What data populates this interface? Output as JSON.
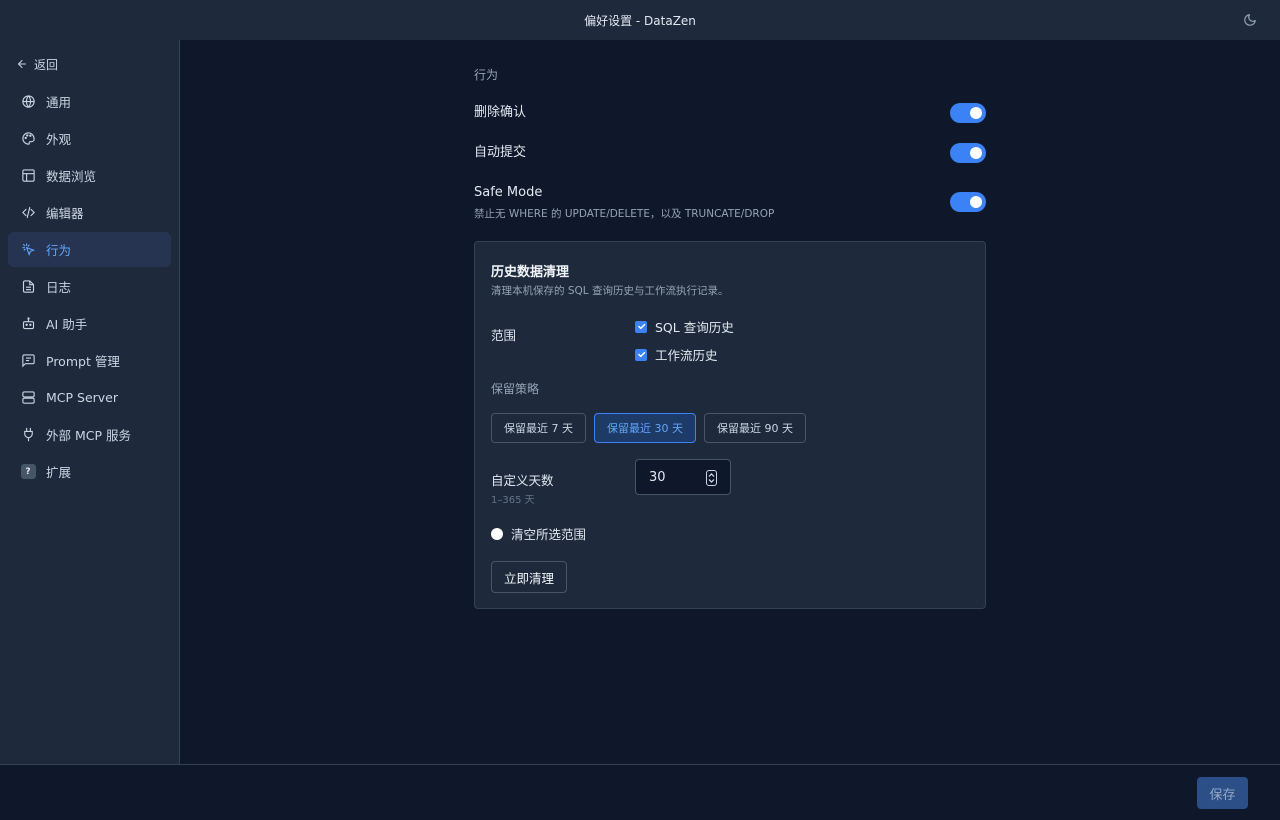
{
  "window": {
    "title": "偏好设置 - DataZen"
  },
  "sidebar": {
    "back_label": "返回",
    "items": [
      {
        "label": "通用",
        "icon": "globe-icon"
      },
      {
        "label": "外观",
        "icon": "palette-icon"
      },
      {
        "label": "数据浏览",
        "icon": "table-icon"
      },
      {
        "label": "编辑器",
        "icon": "code-icon"
      },
      {
        "label": "行为",
        "icon": "pointer-click-icon",
        "active": true
      },
      {
        "label": "日志",
        "icon": "file-text-icon"
      },
      {
        "label": "AI 助手",
        "icon": "bot-icon"
      },
      {
        "label": "Prompt 管理",
        "icon": "message-square-icon"
      },
      {
        "label": "MCP Server",
        "icon": "server-icon"
      },
      {
        "label": "外部 MCP 服务",
        "icon": "plug-icon"
      },
      {
        "label": "扩展",
        "icon": "question-badge-icon"
      }
    ]
  },
  "main": {
    "section_title": "行为",
    "settings": [
      {
        "label": "删除确认",
        "enabled": true
      },
      {
        "label": "自动提交",
        "enabled": true
      },
      {
        "label": "Safe Mode",
        "description": "禁止无 WHERE 的 UPDATE/DELETE，以及 TRUNCATE/DROP",
        "enabled": true
      }
    ],
    "history_card": {
      "title": "历史数据清理",
      "description": "清理本机保存的 SQL 查询历史与工作流执行记录。",
      "range_label": "范围",
      "ranges": [
        {
          "label": "SQL 查询历史",
          "checked": true
        },
        {
          "label": "工作流历史",
          "checked": true
        }
      ],
      "strategy_label": "保留策略",
      "strategies": [
        {
          "label": "保留最近 7 天",
          "selected": false
        },
        {
          "label": "保留最近 30 天",
          "selected": true
        },
        {
          "label": "保留最近 90 天",
          "selected": false
        }
      ],
      "custom_days_label": "自定义天数",
      "custom_days_hint": "1–365 天",
      "custom_days_value": "30",
      "clear_all_label": "清空所选范围",
      "clean_now_label": "立即清理"
    }
  },
  "footer": {
    "save_label": "保存"
  },
  "colors": {
    "accent": "#3b82f6",
    "background": "#0f172a",
    "panel": "#1e293b"
  }
}
